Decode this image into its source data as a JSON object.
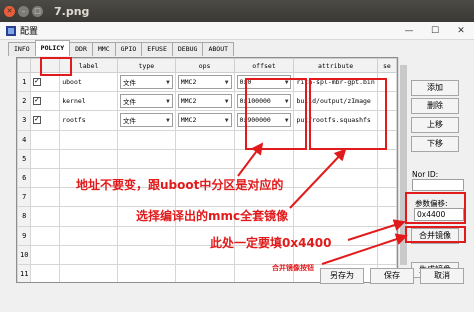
{
  "window": {
    "title": "7.png"
  },
  "dialog": {
    "title": "配置"
  },
  "tabs": [
    "INFO",
    "POLICY",
    "DDR",
    "MMC",
    "GPIO",
    "EFUSE",
    "DEBUG",
    "ABOUT"
  ],
  "grid": {
    "headers": [
      "label",
      "type",
      "ops",
      "offset",
      "attribute",
      "se"
    ],
    "rows": [
      {
        "num": "1",
        "label": "uboot",
        "type": "文件",
        "ops": "MMC2",
        "offset": "0x0",
        "attribute": "rith-spl-mbr-gpt.bin"
      },
      {
        "num": "2",
        "label": "kernel",
        "type": "文件",
        "ops": "MMC2",
        "offset": "0x100000",
        "attribute": "build/output/zImage"
      },
      {
        "num": "3",
        "label": "rootfs",
        "type": "文件",
        "ops": "MMC2",
        "offset": "0x900000",
        "attribute": "put/rootfs.squashfs"
      },
      {
        "num": "4"
      },
      {
        "num": "5"
      },
      {
        "num": "6"
      },
      {
        "num": "7"
      },
      {
        "num": "8"
      },
      {
        "num": "9"
      },
      {
        "num": "10"
      },
      {
        "num": "11"
      }
    ]
  },
  "right": {
    "add": "添加",
    "delete": "删除",
    "up": "上移",
    "down": "下移",
    "nor_id_label": "Nor ID:",
    "param_offset_label": "参数偏移:",
    "param_offset_value": "0x4400",
    "merge": "合并镜像",
    "generate": "生成镜像"
  },
  "bottom": {
    "save_as": "另存为",
    "save": "保存",
    "cancel": "取消"
  },
  "annotations": {
    "a1": "地址不要变，跟uboot中分区是对应的",
    "a2": "选择编译出的mmc全套镜像",
    "a3": "此处一定要填0x4400",
    "a4": "合并镜像按钮"
  },
  "colors": {
    "annotation": "#e11b1b",
    "ubuntu_close": "#e95e3a"
  }
}
